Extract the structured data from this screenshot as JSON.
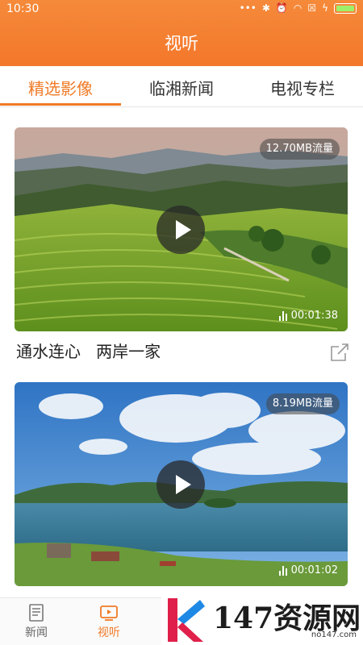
{
  "status": {
    "time": "10:30"
  },
  "header": {
    "title": "视听"
  },
  "tabs": [
    {
      "label": "精选影像",
      "active": true
    },
    {
      "label": "临湘新闻",
      "active": false
    },
    {
      "label": "电视专栏",
      "active": false
    }
  ],
  "videos": [
    {
      "data_usage": "12.70MB流量",
      "duration": "00:01:38",
      "title": "通水连心   两岸一家"
    },
    {
      "data_usage": "8.19MB流量",
      "duration": "00:01:02",
      "title": ""
    }
  ],
  "bottom_nav": [
    {
      "label": "新闻",
      "icon": "news-icon",
      "active": false
    },
    {
      "label": "视听",
      "icon": "video-icon",
      "active": true
    }
  ],
  "watermark": {
    "text": "147资源网",
    "url": "no147.com"
  },
  "colors": {
    "accent": "#f07a26",
    "header": "#f4772b"
  }
}
